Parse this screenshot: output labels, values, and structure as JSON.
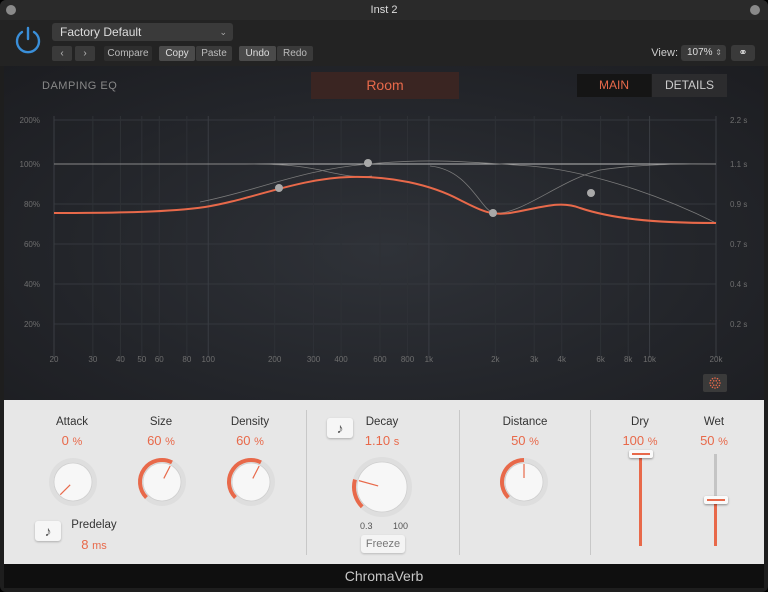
{
  "window": {
    "title": "Inst 2"
  },
  "toolbar": {
    "preset": "Factory Default",
    "back": "‹",
    "forward": "›",
    "compare": "Compare",
    "copy": "Copy",
    "paste": "Paste",
    "undo": "Undo",
    "redo": "Redo",
    "view_label": "View:",
    "zoom": "107%"
  },
  "eq": {
    "title": "DAMPING EQ",
    "preset_name": "Room",
    "tab_main": "MAIN",
    "tab_details": "DETAILS",
    "left_ticks": [
      "200%",
      "100%",
      "80%",
      "60%",
      "40%",
      "20%"
    ],
    "right_ticks": [
      "2.2 s",
      "1.1 s",
      "0.9 s",
      "0.7 s",
      "0.4 s",
      "0.2 s"
    ],
    "freq_ticks": [
      "20",
      "30",
      "40",
      "50",
      "60",
      "80",
      "100",
      "200",
      "300",
      "400",
      "600",
      "800",
      "1k",
      "2k",
      "3k",
      "4k",
      "6k",
      "8k",
      "10k",
      "20k"
    ],
    "accent": "#e8694a"
  },
  "controls": {
    "attack": {
      "label": "Attack",
      "value": "0",
      "unit": "%"
    },
    "size": {
      "label": "Size",
      "value": "60",
      "unit": "%"
    },
    "density": {
      "label": "Density",
      "value": "60",
      "unit": "%"
    },
    "predelay": {
      "label": "Predelay",
      "value": "8",
      "unit": "ms"
    },
    "decay": {
      "label": "Decay",
      "value": "1.10",
      "unit": "s",
      "min": "0.3",
      "max": "100"
    },
    "freeze": "Freeze",
    "distance": {
      "label": "Distance",
      "value": "50",
      "unit": "%"
    },
    "dry": {
      "label": "Dry",
      "value": "100",
      "unit": "%"
    },
    "wet": {
      "label": "Wet",
      "value": "50",
      "unit": "%"
    }
  },
  "footer": {
    "plugin_name": "ChromaVerb"
  }
}
